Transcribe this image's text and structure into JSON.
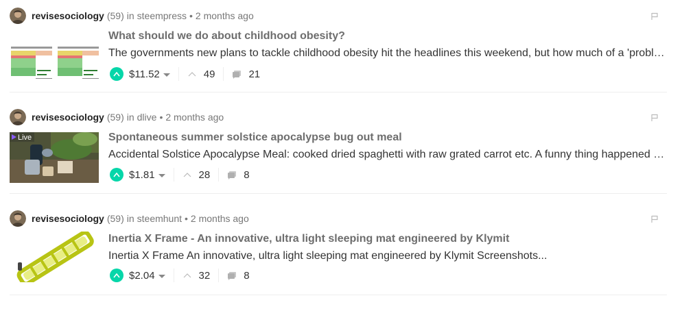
{
  "posts": [
    {
      "author": "revisesociology",
      "reputation": "(59)",
      "in_label": "in",
      "community": "steempress",
      "time": "2 months ago",
      "title": "What should we do about childhood obesity?",
      "summary": "The governments new plans to tackle childhood obesity hit the headlines this weekend, but how much of a 'problem' is childhood obesity?",
      "payout": "$11.52",
      "votes": "49",
      "comments": "21",
      "thumbnail_type": "chart-tables"
    },
    {
      "author": "revisesociology",
      "reputation": "(59)",
      "in_label": "in",
      "community": "dlive",
      "time": "2 months ago",
      "title": "Spontaneous summer solstice apocalypse bug out meal",
      "summary": "Accidental Solstice Apocalypse Meal: cooked dried spaghetti with raw grated carrot etc. A funny thing happened to me the other day",
      "payout": "$1.81",
      "votes": "28",
      "comments": "8",
      "thumbnail_type": "dlive-video",
      "thumbnail_badge": "Live"
    },
    {
      "author": "revisesociology",
      "reputation": "(59)",
      "in_label": "in",
      "community": "steemhunt",
      "time": "2 months ago",
      "title": "Inertia X Frame - An innovative, ultra light sleeping mat engineered by Klymit",
      "summary": "Inertia X Frame An innovative, ultra light sleeping mat engineered by Klymit Screenshots...",
      "payout": "$2.04",
      "votes": "32",
      "comments": "8",
      "thumbnail_type": "sleeping-mat"
    }
  ],
  "colors": {
    "upvote": "#06d6a9",
    "title": "#6d6d6d",
    "meta": "#777777",
    "separator": "#eeeeee"
  },
  "icons": [
    "avatar",
    "flag-icon",
    "upvote-icon",
    "dropdown-caret-icon",
    "votes-icon",
    "comments-icon"
  ]
}
